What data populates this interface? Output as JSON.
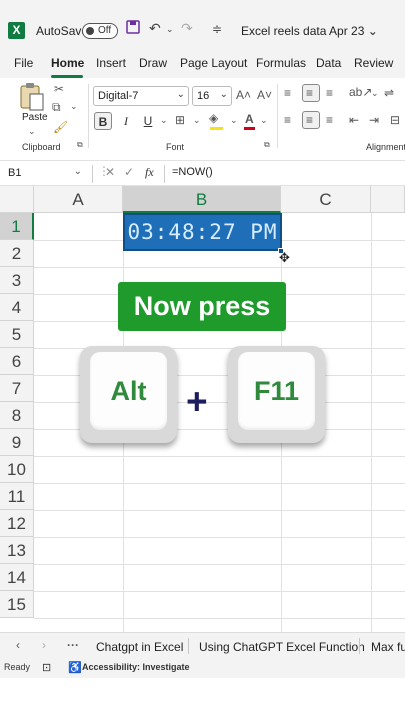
{
  "titlebar": {
    "app_icon": "X",
    "autosave_label": "AutoSave",
    "toggle_state": "Off",
    "doc_title": "Excel reels data Apr 23 ⌄"
  },
  "menu": {
    "tabs": [
      "File",
      "Home",
      "Insert",
      "Draw",
      "Page Layout",
      "Formulas",
      "Data",
      "Review"
    ],
    "active": "Home"
  },
  "ribbon": {
    "paste_label": "Paste",
    "clipboard_label": "Clipboard",
    "font_label": "Font",
    "alignment_label": "Alignment",
    "font_name": "Digital-7",
    "font_size": "16",
    "bold": "B",
    "italic": "I",
    "underline": "U"
  },
  "formula_bar": {
    "name_box": "B1",
    "formula": "=NOW()"
  },
  "grid": {
    "columns": [
      "A",
      "B",
      "C"
    ],
    "rows": [
      "1",
      "2",
      "3",
      "4",
      "5",
      "6",
      "7",
      "8",
      "9",
      "10",
      "11",
      "12",
      "13",
      "14",
      "15"
    ],
    "selected_column": "B",
    "selected_row": "1",
    "active_cell_value": "03:48:27 PM"
  },
  "overlay": {
    "banner": "Now press",
    "key1": "Alt",
    "plus": "+",
    "key2": "F11"
  },
  "sheets": {
    "tabs": [
      "Chatgpt in Excel",
      "Using ChatGPT Excel Function",
      "Max fu"
    ]
  },
  "status": {
    "ready": "Ready",
    "accessibility": "Accessibility: Investigate"
  },
  "colors": {
    "excel_green": "#107c41",
    "banner_green": "#1f9b2c",
    "cell_blue": "#1e6fb8"
  }
}
